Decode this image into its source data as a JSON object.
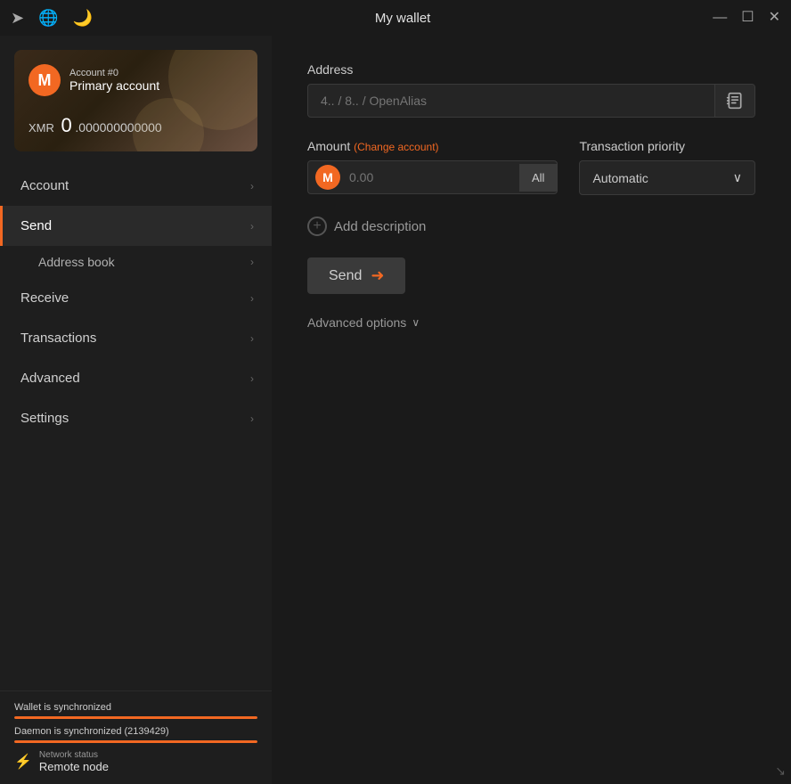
{
  "titleBar": {
    "title": "My wallet",
    "icons": {
      "transfer": "➤",
      "globe": "🌐",
      "moon": "🌙"
    },
    "controls": {
      "minimize": "—",
      "maximize": "☐",
      "close": "✕"
    }
  },
  "sidebar": {
    "wallet": {
      "account_label": "Account #0",
      "account_name": "Primary account",
      "currency": "XMR",
      "balance_integer": "0",
      "balance_decimal": ".000000000000"
    },
    "nav": [
      {
        "id": "account",
        "label": "Account",
        "active": false,
        "hasChevron": true
      },
      {
        "id": "send",
        "label": "Send",
        "active": true,
        "hasChevron": true
      },
      {
        "id": "address-book",
        "label": "Address book",
        "active": false,
        "hasChevron": true,
        "sub": true
      },
      {
        "id": "receive",
        "label": "Receive",
        "active": false,
        "hasChevron": true
      },
      {
        "id": "transactions",
        "label": "Transactions",
        "active": false,
        "hasChevron": true
      },
      {
        "id": "advanced",
        "label": "Advanced",
        "active": false,
        "hasChevron": true
      },
      {
        "id": "settings",
        "label": "Settings",
        "active": false,
        "hasChevron": true
      }
    ],
    "status": {
      "wallet_sync_label": "Wallet is synchronized",
      "wallet_sync_percent": 100,
      "daemon_sync_label": "Daemon is synchronized (2139429)",
      "daemon_sync_percent": 100,
      "network_label": "Network status",
      "network_value": "Remote node"
    }
  },
  "main": {
    "address": {
      "label": "Address",
      "placeholder": "4.. / 8.. / OpenAlias"
    },
    "amount": {
      "label": "Amount",
      "change_account_label": "(Change account)",
      "placeholder": "0.00",
      "all_button": "All"
    },
    "priority": {
      "label": "Transaction priority",
      "selected": "Automatic"
    },
    "add_description": {
      "label": "Add description"
    },
    "send_button": "Send",
    "advanced_options": {
      "label": "Advanced options"
    }
  }
}
